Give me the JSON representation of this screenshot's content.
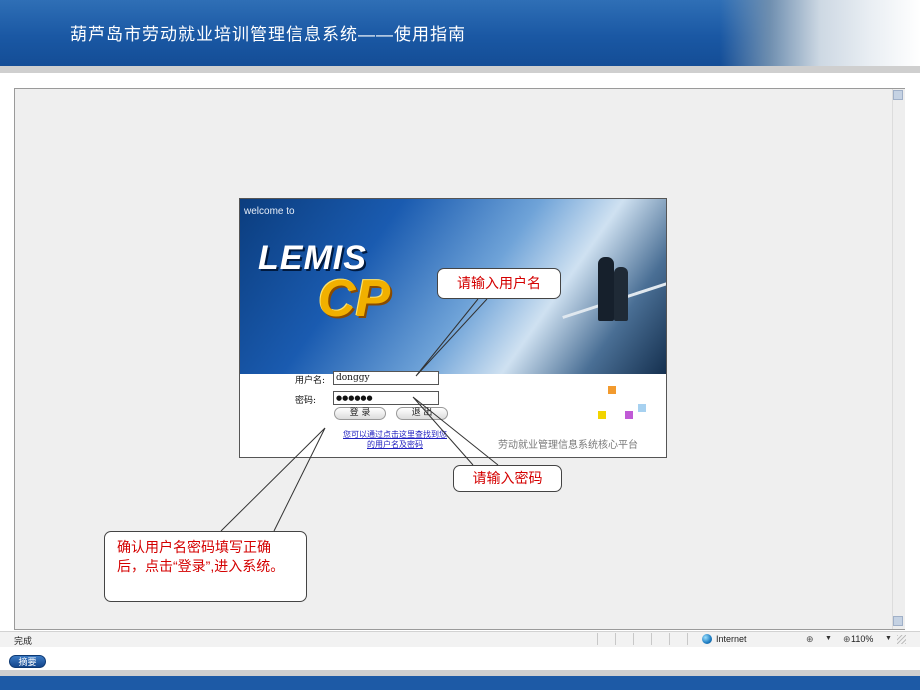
{
  "banner": {
    "title": "葫芦岛市劳动就业培训管理信息系统——使用指南",
    "colors": {
      "primary": "#1a58a4",
      "callout_text": "#d40000"
    }
  },
  "login": {
    "welcome": "welcome to",
    "logo_text": "LEMIS",
    "logo_cp": "CP",
    "username_label": "用户名:",
    "username_value": "donggy",
    "password_label": "密码:",
    "password_value": "●●●●●●",
    "login_button": "登 录",
    "exit_button": "退 出",
    "forgot_link_line1": "您可以通过点击这里查找到您",
    "forgot_link_line2": "的用户名及密码",
    "platform": "劳动就业管理信息系统核心平台"
  },
  "callouts": {
    "username": "请输入用户名",
    "password": "请输入密码",
    "confirm": "确认用户名密码填写正确后，点击“登录”,进入系统。"
  },
  "statusbar": {
    "status": "完成",
    "zone": "Internet",
    "zoom": "110%",
    "icons": [
      "globe-icon",
      "lock-icon",
      "zoom-icon",
      "resize-grip-icon"
    ]
  },
  "summary_button": "摘要"
}
